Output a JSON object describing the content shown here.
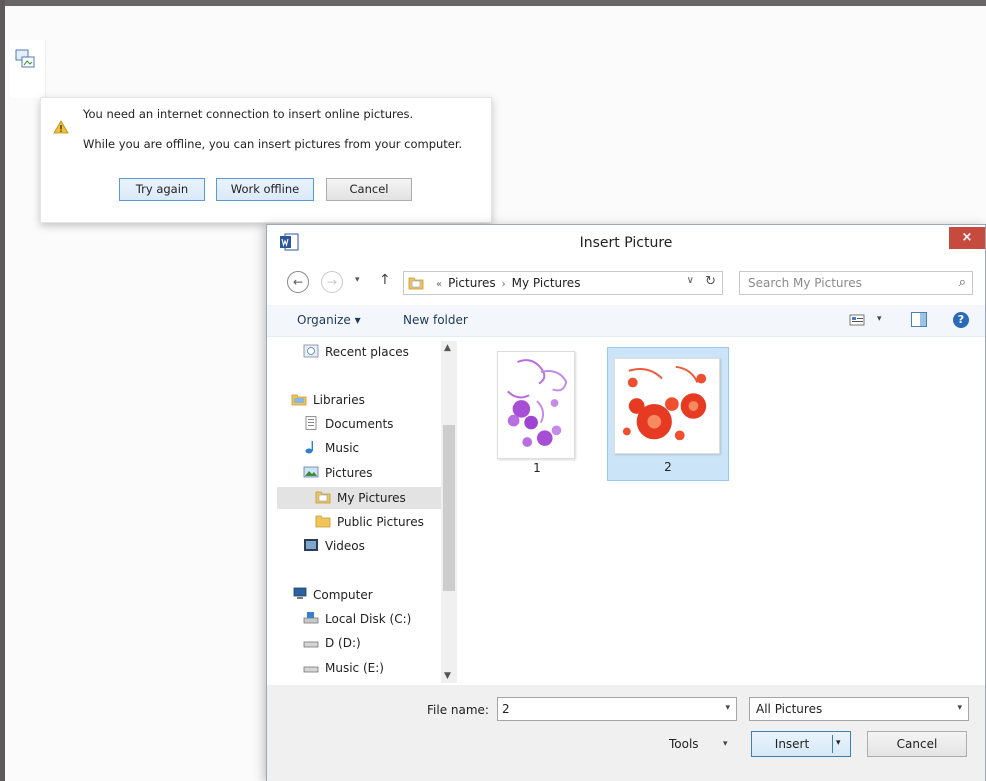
{
  "colors": {
    "frame": "#6a6566",
    "dialog_close": "#c74a3f",
    "selection": "#cce4f7",
    "link": "#1e395b",
    "flower_purple": "#a64fd6",
    "flower_red": "#e63b22"
  },
  "broken_image": {
    "icon": "broken-picture-icon"
  },
  "offline_notice": {
    "icon": "warning-icon",
    "message_1": "You need an internet connection to insert online pictures.",
    "message_2": "While you are offline, you can insert pictures from your computer.",
    "buttons": {
      "try_again": "Try again",
      "work_offline": "Work offline",
      "cancel": "Cancel"
    }
  },
  "dialog": {
    "title": "Insert Picture",
    "app_icon": "word-icon",
    "close_label": "×",
    "nav": {
      "back": "←",
      "forward": "→",
      "recent": "▾",
      "up": "↑",
      "breadcrumb_prefix": "«",
      "breadcrumb": [
        "Pictures",
        "My Pictures"
      ],
      "dropdown": "∨",
      "refresh": "↻"
    },
    "search": {
      "placeholder": "Search My Pictures",
      "icon": "⌕"
    },
    "toolbar": {
      "organize": "Organize ▾",
      "new_folder": "New folder",
      "views_dd": "▾",
      "help": "?"
    },
    "nav_pane": [
      {
        "label": "Recent places",
        "icon": "recent-places-icon",
        "indent": 1
      },
      {
        "label": "Libraries",
        "icon": "libraries-icon",
        "indent": 0
      },
      {
        "label": "Documents",
        "icon": "documents-icon",
        "indent": 1
      },
      {
        "label": "Music",
        "icon": "music-icon",
        "indent": 1
      },
      {
        "label": "Pictures",
        "icon": "pictures-icon",
        "indent": 1
      },
      {
        "label": "My Pictures",
        "icon": "folder-icon",
        "indent": 2,
        "selected": true
      },
      {
        "label": "Public Pictures",
        "icon": "folder-icon",
        "indent": 2
      },
      {
        "label": "Videos",
        "icon": "videos-icon",
        "indent": 1
      },
      {
        "label": "Computer",
        "icon": "computer-icon",
        "indent": 0
      },
      {
        "label": "Local Disk (C:)",
        "icon": "drive-icon",
        "indent": 1
      },
      {
        "label": "D (D:)",
        "icon": "drive-icon",
        "indent": 1
      },
      {
        "label": "Music (E:)",
        "icon": "drive-icon",
        "indent": 1
      }
    ],
    "scroll": {
      "up": "▲",
      "down": "▼"
    },
    "files": [
      {
        "name": "1",
        "thumbnail": "purple-flower-icon"
      },
      {
        "name": "2",
        "thumbnail": "red-flower-icon",
        "selected": true
      }
    ],
    "bottom": {
      "file_name_label": "File name:",
      "file_name_value": "2",
      "file_type": "All Pictures",
      "tools": "Tools",
      "insert": "Insert",
      "cancel": "Cancel",
      "dd": "▾"
    }
  }
}
